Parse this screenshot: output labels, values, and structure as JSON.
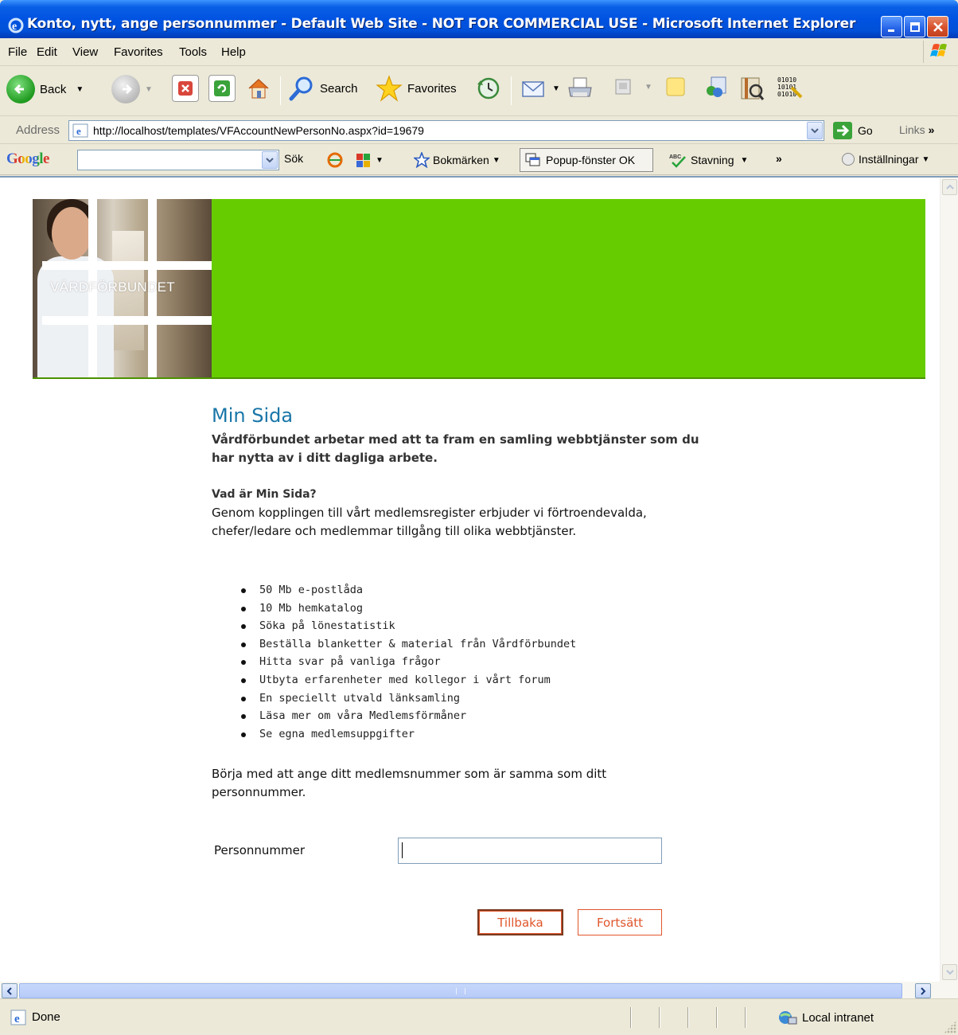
{
  "window": {
    "title": "Konto, nytt, ange personnummer - Default Web Site - NOT FOR COMMERCIAL USE - Microsoft Internet Explorer"
  },
  "menubar": {
    "items": [
      "File",
      "Edit",
      "View",
      "Favorites",
      "Tools",
      "Help"
    ]
  },
  "toolbar": {
    "back_label": "Back",
    "search_label": "Search",
    "favorites_label": "Favorites"
  },
  "addressbar": {
    "label": "Address",
    "url": "http://localhost/templates/VFAccountNewPersonNo.aspx?id=19679",
    "go_label": "Go",
    "links_label": "Links"
  },
  "googlebar": {
    "logo": "Google",
    "search_label": "Sök",
    "bookmarks_label": "Bokmärken",
    "popup_label": "Popup-fönster OK",
    "spelling_label": "Stavning",
    "settings_label": "Inställningar"
  },
  "banner": {
    "logo_text": "VÅRDFÖRBUNDET",
    "colors": {
      "banner_green": "#66cc00"
    }
  },
  "page": {
    "title": "Min Sida",
    "lead": "Vårdförbundet arbetar med att ta fram en samling webbtjänster som du har nytta av i ditt dagliga arbete.",
    "question_heading": "Vad är Min Sida?",
    "question_body": "Genom kopplingen till vårt medlemsregister erbjuder vi förtroendevalda, chefer/ledare och medlemmar tillgång till olika webbtjänster.",
    "services": [
      "50 Mb e-postlåda",
      "10 Mb hemkatalog",
      "Söka på lönestatistik",
      "Beställa blanketter & material från Vårdförbundet",
      "Hitta svar på vanliga frågor",
      "Utbyta erfarenheter med kollegor i vårt forum",
      "En speciellt utvald länksamling",
      "Läsa mer om våra Medlemsförmåner",
      "Se egna medlemsuppgifter"
    ],
    "instruction": "Börja med att ange ditt medlemsnummer som är samma som ditt personnummer.",
    "form": {
      "personnummer_label": "Personnummer",
      "personnummer_value": ""
    },
    "buttons": {
      "back": "Tillbaka",
      "next": "Fortsätt"
    },
    "colors": {
      "title": "#1976a8",
      "button_text": "#e0562b"
    }
  },
  "statusbar": {
    "status": "Done",
    "zone": "Local intranet"
  }
}
